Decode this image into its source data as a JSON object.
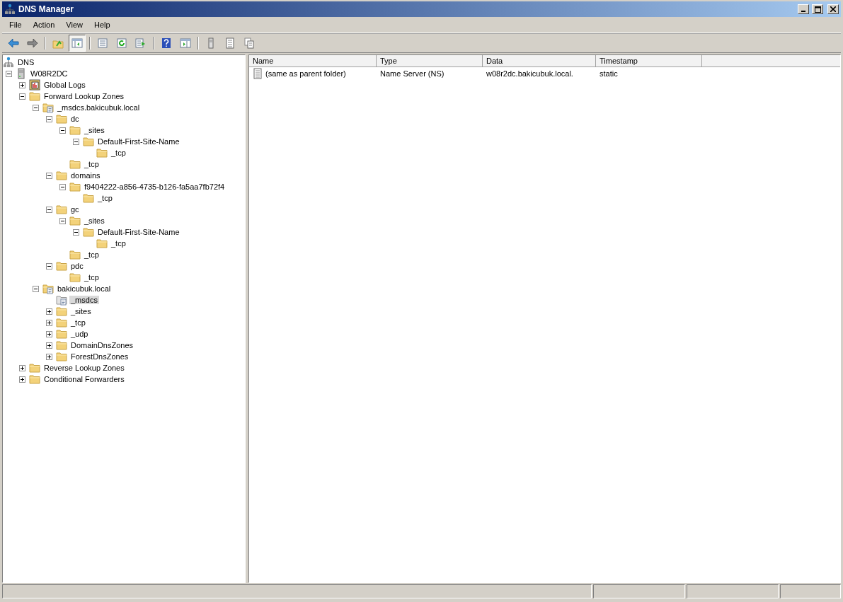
{
  "window": {
    "title": "DNS Manager"
  },
  "menu": [
    "File",
    "Action",
    "View",
    "Help"
  ],
  "toolbar": [
    {
      "kind": "back",
      "pressed": false
    },
    {
      "kind": "forward",
      "pressed": false
    },
    {
      "kind": "sep"
    },
    {
      "kind": "up",
      "pressed": false
    },
    {
      "kind": "tree",
      "pressed": true
    },
    {
      "kind": "sep"
    },
    {
      "kind": "properties",
      "pressed": false
    },
    {
      "kind": "refresh",
      "pressed": false
    },
    {
      "kind": "export",
      "pressed": false
    },
    {
      "kind": "sep"
    },
    {
      "kind": "help",
      "pressed": false
    },
    {
      "kind": "pane",
      "pressed": false
    },
    {
      "kind": "sep"
    },
    {
      "kind": "server",
      "pressed": false
    },
    {
      "kind": "list",
      "pressed": false
    },
    {
      "kind": "copy",
      "pressed": false
    }
  ],
  "tree": {
    "label": "DNS",
    "kind": "dns",
    "selected": false,
    "children": [
      {
        "label": "W08R2DC",
        "kind": "server",
        "expanded": true,
        "selected": false,
        "children": [
          {
            "label": "Global Logs",
            "kind": "logs",
            "expanded": false,
            "selected": false
          },
          {
            "label": "Forward Lookup Zones",
            "kind": "folder",
            "expanded": true,
            "selected": false,
            "children": [
              {
                "label": "_msdcs.bakicubuk.local",
                "kind": "zone",
                "expanded": true,
                "selected": false,
                "children": [
                  {
                    "label": "dc",
                    "kind": "folder",
                    "expanded": true,
                    "selected": false,
                    "children": [
                      {
                        "label": "_sites",
                        "kind": "folder",
                        "expanded": true,
                        "selected": false,
                        "children": [
                          {
                            "label": "Default-First-Site-Name",
                            "kind": "folder",
                            "expanded": true,
                            "selected": false,
                            "children": [
                              {
                                "label": "_tcp",
                                "kind": "folder",
                                "selected": false
                              }
                            ]
                          }
                        ]
                      },
                      {
                        "label": "_tcp",
                        "kind": "folder",
                        "selected": false
                      }
                    ]
                  },
                  {
                    "label": "domains",
                    "kind": "folder",
                    "expanded": true,
                    "selected": false,
                    "children": [
                      {
                        "label": "f9404222-a856-4735-b126-fa5aa7fb72f4",
                        "kind": "folder",
                        "expanded": true,
                        "selected": false,
                        "children": [
                          {
                            "label": "_tcp",
                            "kind": "folder",
                            "selected": false
                          }
                        ]
                      }
                    ]
                  },
                  {
                    "label": "gc",
                    "kind": "folder",
                    "expanded": true,
                    "selected": false,
                    "children": [
                      {
                        "label": "_sites",
                        "kind": "folder",
                        "expanded": true,
                        "selected": false,
                        "children": [
                          {
                            "label": "Default-First-Site-Name",
                            "kind": "folder",
                            "expanded": true,
                            "selected": false,
                            "children": [
                              {
                                "label": "_tcp",
                                "kind": "folder",
                                "selected": false
                              }
                            ]
                          }
                        ]
                      },
                      {
                        "label": "_tcp",
                        "kind": "folder",
                        "selected": false
                      }
                    ]
                  },
                  {
                    "label": "pdc",
                    "kind": "folder",
                    "expanded": true,
                    "selected": false,
                    "children": [
                      {
                        "label": "_tcp",
                        "kind": "folder",
                        "selected": false
                      }
                    ]
                  }
                ]
              },
              {
                "label": "bakicubuk.local",
                "kind": "zone",
                "expanded": true,
                "selected": false,
                "children": [
                  {
                    "label": "_msdcs",
                    "kind": "delegation",
                    "selected": true
                  },
                  {
                    "label": "_sites",
                    "kind": "folder",
                    "expanded": false,
                    "selected": false
                  },
                  {
                    "label": "_tcp",
                    "kind": "folder",
                    "expanded": false,
                    "selected": false
                  },
                  {
                    "label": "_udp",
                    "kind": "folder",
                    "expanded": false,
                    "selected": false
                  },
                  {
                    "label": "DomainDnsZones",
                    "kind": "folder",
                    "expanded": false,
                    "selected": false
                  },
                  {
                    "label": "ForestDnsZones",
                    "kind": "folder",
                    "expanded": false,
                    "selected": false
                  }
                ]
              }
            ]
          },
          {
            "label": "Reverse Lookup Zones",
            "kind": "folder",
            "expanded": false,
            "selected": false
          },
          {
            "label": "Conditional Forwarders",
            "kind": "folder",
            "expanded": false,
            "selected": false
          }
        ]
      }
    ]
  },
  "table": {
    "columns": [
      "Name",
      "Type",
      "Data",
      "Timestamp"
    ],
    "rows": [
      {
        "cells": [
          "(same as parent folder)",
          "Name Server (NS)",
          "w08r2dc.bakicubuk.local.",
          "static"
        ]
      }
    ]
  }
}
